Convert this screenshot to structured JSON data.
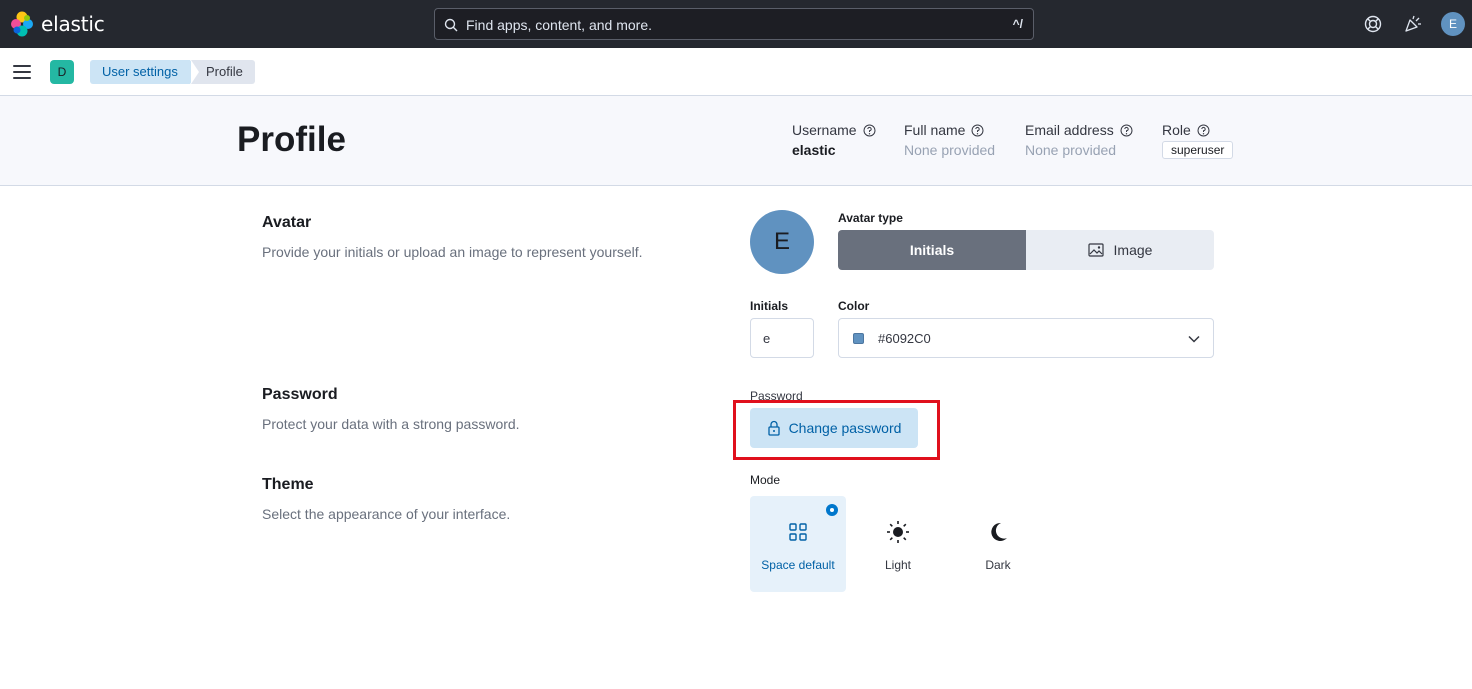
{
  "header": {
    "logo_text": "elastic",
    "search": {
      "placeholder": "Find apps, content, and more.",
      "shortcut": "^/"
    },
    "icons": [
      "help-icon",
      "newsfeed-icon"
    ],
    "user_avatar": "E"
  },
  "nav": {
    "space_badge": "D",
    "breadcrumbs": [
      "User settings",
      "Profile"
    ]
  },
  "page": {
    "title": "Profile",
    "meta": {
      "username_label": "Username",
      "username_value": "elastic",
      "fullname_label": "Full name",
      "fullname_value": "None provided",
      "email_label": "Email address",
      "email_value": "None provided",
      "role_label": "Role",
      "role_value": "superuser"
    }
  },
  "avatar_section": {
    "title": "Avatar",
    "description": "Provide your initials or upload an image to represent yourself.",
    "preview_letter": "E",
    "type_label": "Avatar type",
    "type_options": [
      "Initials",
      "Image"
    ],
    "selected_type": "Initials",
    "initials_label": "Initials",
    "initials_value": "e",
    "color_label": "Color",
    "color_value": "#6092C0"
  },
  "password_section": {
    "title": "Password",
    "description": "Protect your data with a strong password.",
    "field_label": "Password",
    "button_label": "Change password"
  },
  "theme_section": {
    "title": "Theme",
    "description": "Select the appearance of your interface.",
    "mode_label": "Mode",
    "modes": [
      "Space default",
      "Light",
      "Dark"
    ],
    "selected_mode": "Space default"
  },
  "colors": {
    "header_bg": "#25282f",
    "accent": "#0077cc",
    "avatar": "#6092c0",
    "highlight_box": "#e0101d"
  }
}
